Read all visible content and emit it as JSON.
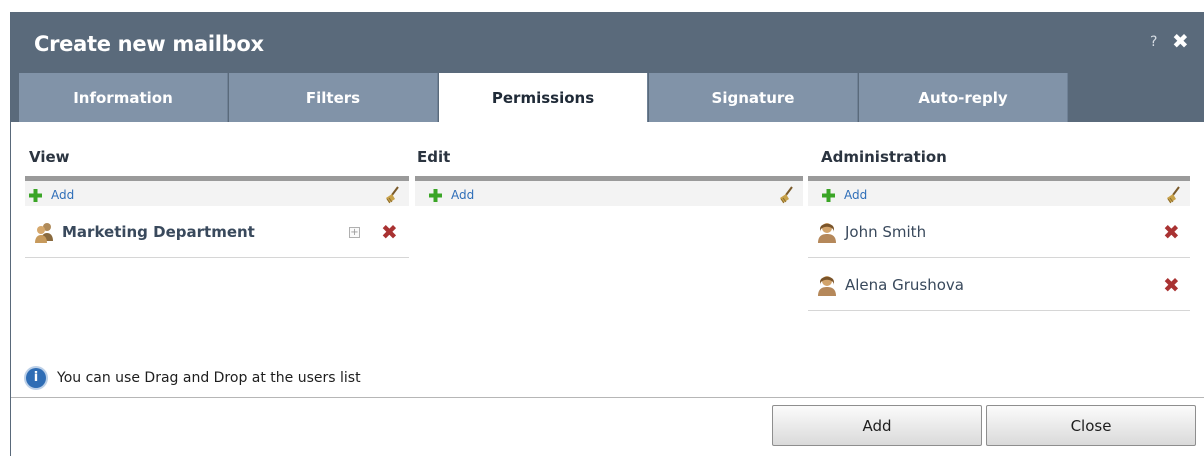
{
  "dialog": {
    "title": "Create new mailbox",
    "help_label": "?",
    "close_glyph": "✖"
  },
  "tabs": [
    {
      "label": "Information",
      "active": false
    },
    {
      "label": "Filters",
      "active": false
    },
    {
      "label": "Permissions",
      "active": true
    },
    {
      "label": "Signature",
      "active": false
    },
    {
      "label": "Auto-reply",
      "active": false
    }
  ],
  "columns": {
    "view": {
      "title": "View",
      "add_label": "Add",
      "entries": [
        {
          "label": "Marketing Department",
          "kind": "group",
          "expand": "+"
        }
      ]
    },
    "edit": {
      "title": "Edit",
      "add_label": "Add",
      "entries": []
    },
    "administration": {
      "title": "Administration",
      "add_label": "Add",
      "entries": [
        {
          "label": "John Smith",
          "kind": "user"
        },
        {
          "label": "Alena Grushova",
          "kind": "user"
        }
      ]
    }
  },
  "delete_glyph": "✖",
  "hint": {
    "icon": "info-icon",
    "glyph": "i",
    "text": "You can use Drag and Drop at the users list"
  },
  "footer": {
    "add_label": "Add",
    "close_label": "Close"
  },
  "colors": {
    "titlebar": "#5a6a7b",
    "tab_inactive": "#8193a8",
    "tab_active": "#ffffff",
    "link": "#2e6eb8",
    "delete": "#a93232"
  }
}
